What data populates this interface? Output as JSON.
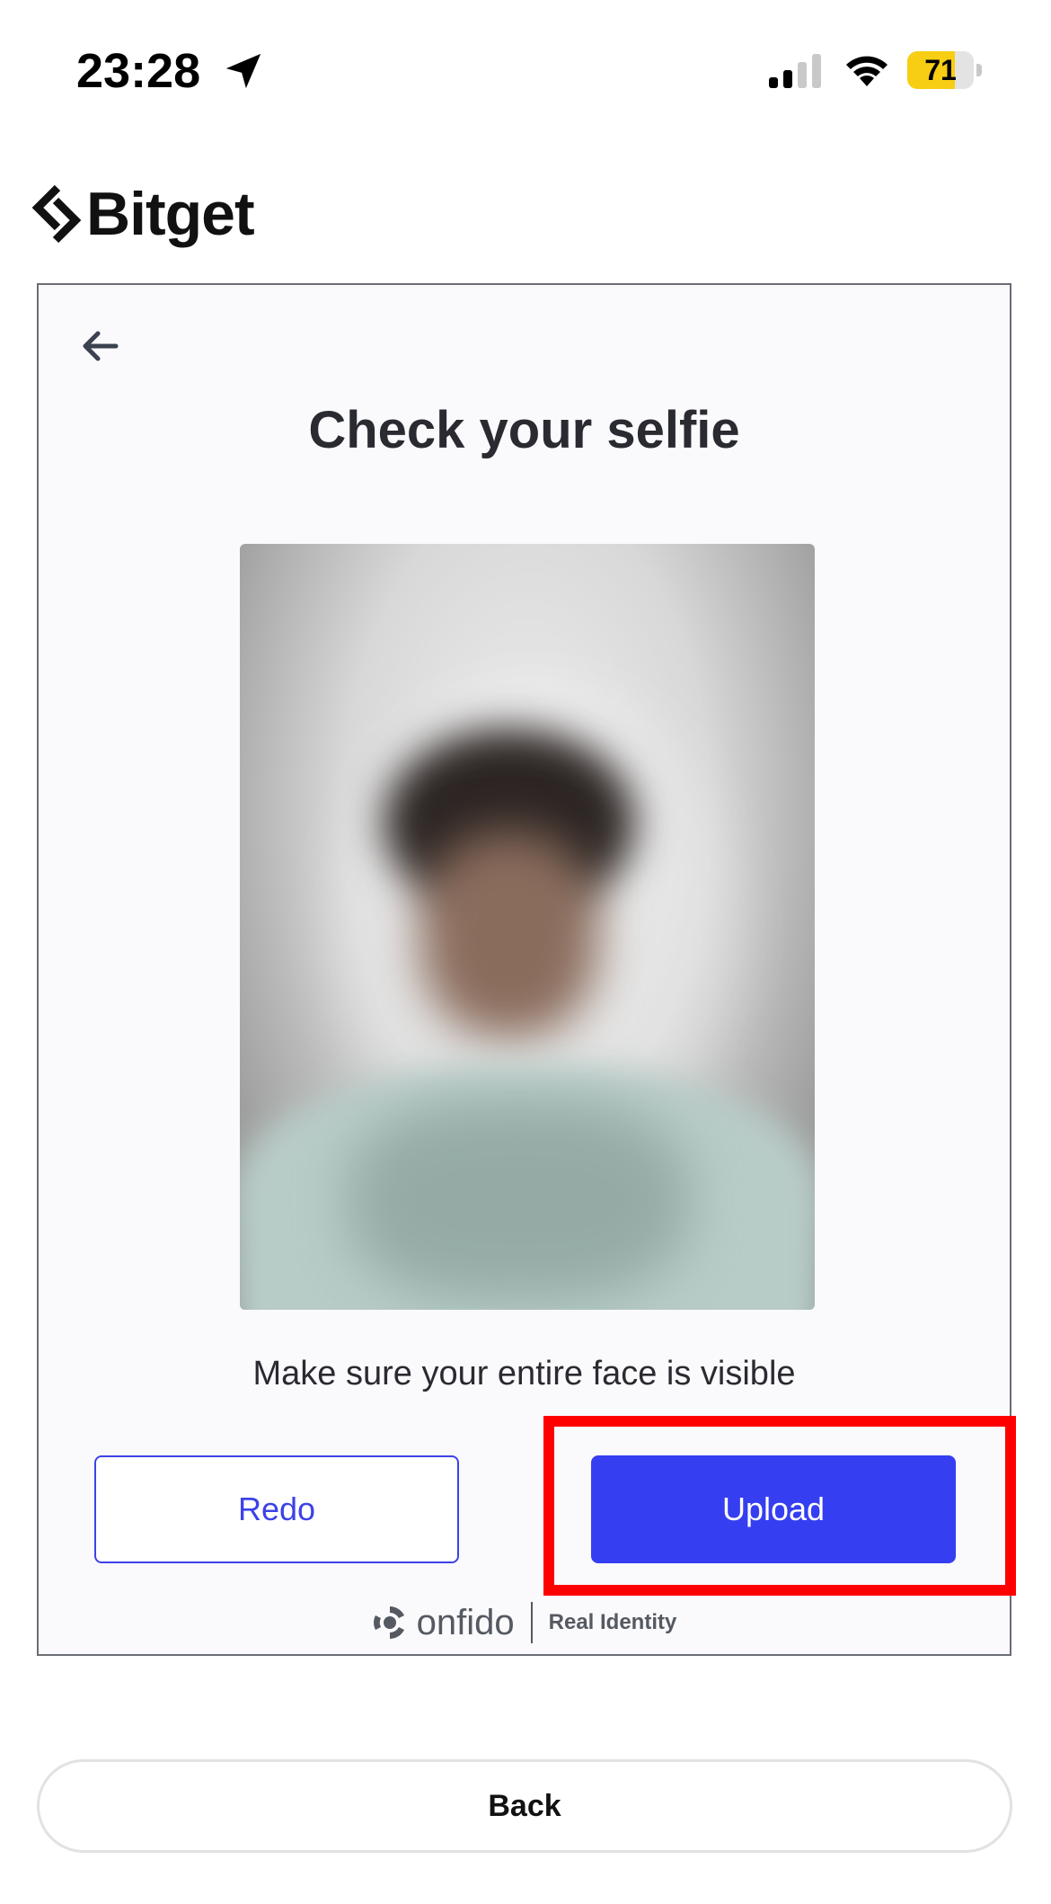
{
  "status_bar": {
    "time": "23:28",
    "battery_level": "71",
    "battery_fraction": 0.71,
    "icons": [
      "location-arrow-icon",
      "cellular-signal-icon",
      "wifi-icon",
      "battery-icon"
    ]
  },
  "brand": {
    "logo_text": "Bitget"
  },
  "card": {
    "title": "Check your selfie",
    "hint": "Make sure your entire face is visible",
    "redo_label": "Redo",
    "upload_label": "Upload",
    "powered_by_brand": "onfido",
    "powered_by_tagline": "Real Identity"
  },
  "footer": {
    "back_label": "Back"
  },
  "colors": {
    "accent": "#353ef0",
    "highlight": "#ff0000",
    "battery": "#f7ce14"
  }
}
